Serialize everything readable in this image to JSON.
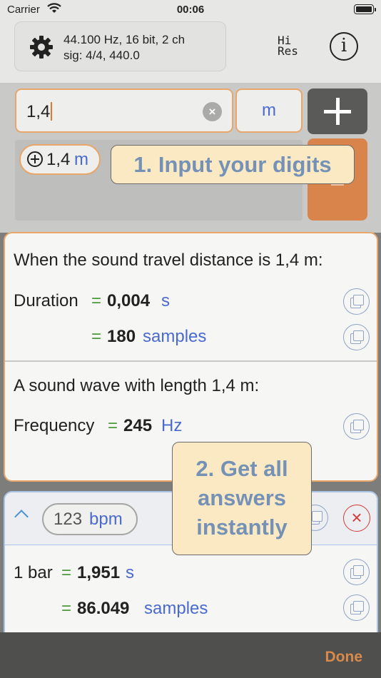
{
  "status_bar": {
    "carrier": "Carrier",
    "time": "00:06"
  },
  "toolbar": {
    "audio_line1": "44.100 Hz, 16 bit, 2 ch",
    "audio_line2": "sig: 4/4, 440.0",
    "hires_line1": "Hi",
    "hires_line2": "Res",
    "info_label": "i"
  },
  "input": {
    "value": "1,4",
    "clear_label": "×",
    "unit": "m"
  },
  "entries": [
    {
      "value": "1,4",
      "unit": "m"
    }
  ],
  "distance_section": {
    "heading": "When the sound travel distance is 1,4 m:",
    "rows": [
      {
        "label": "Duration",
        "eq": "=",
        "value": "0,004",
        "unit": "s"
      },
      {
        "label": "",
        "eq": "=",
        "value": "180",
        "unit": "samples"
      }
    ]
  },
  "wave_section": {
    "heading": "A sound wave with length 1,4 m:",
    "rows": [
      {
        "label": "Frequency",
        "eq": "=",
        "value": "245",
        "unit": "Hz"
      }
    ]
  },
  "tempo_card": {
    "bpm_value": "123",
    "bpm_unit": "bpm",
    "close_label": "×",
    "rows": [
      {
        "label": "1 bar",
        "eq": "=",
        "value": "1,951",
        "unit": "s"
      },
      {
        "label": "",
        "eq": "=",
        "value": "86.049",
        "unit": "samples"
      }
    ]
  },
  "callouts": {
    "step1": "1. Input your digits",
    "step2_line1": "2. Get all",
    "step2_line2": "answers",
    "step2_line3": "instantly"
  },
  "bottom_bar": {
    "done_label": "Done"
  },
  "colors": {
    "accent_orange": "#e8a66a",
    "unit_blue": "#4a6ad0",
    "equals_green": "#4a9a3a",
    "close_red": "#d63a3a",
    "callout_bg": "#fbe9c4",
    "callout_text": "#7592b6"
  }
}
